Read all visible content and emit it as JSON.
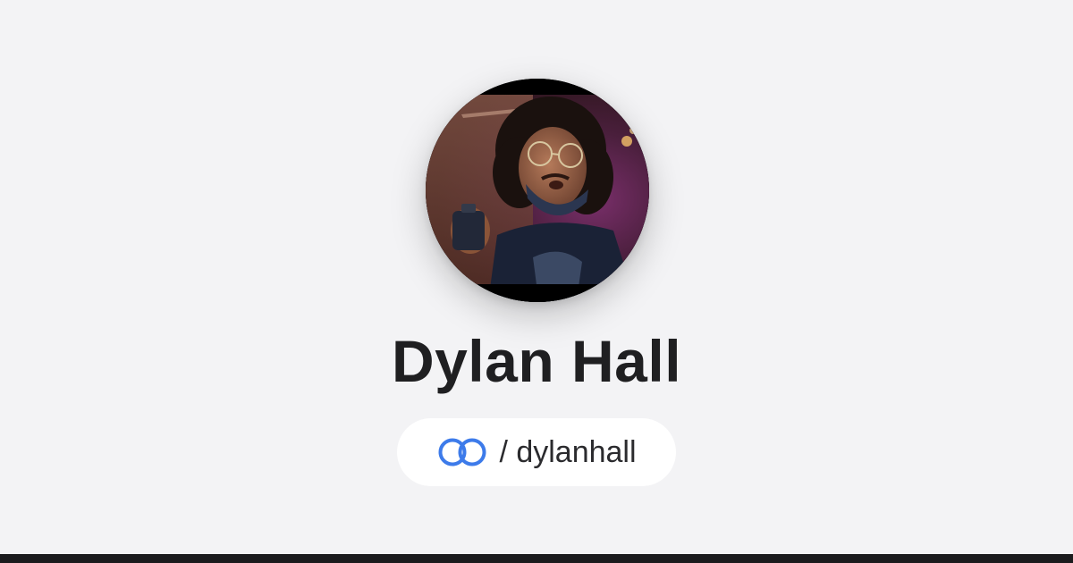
{
  "profile": {
    "name": "Dylan Hall",
    "handle": "/ dylanhall",
    "avatar_alt": "Profile photo"
  },
  "icons": {
    "link": "linked-rings-icon"
  },
  "colors": {
    "background": "#f3f3f5",
    "text": "#1f1f21",
    "pill": "#ffffff",
    "accent": "#3d7bea",
    "bottom_bar": "#1b1b1d"
  }
}
